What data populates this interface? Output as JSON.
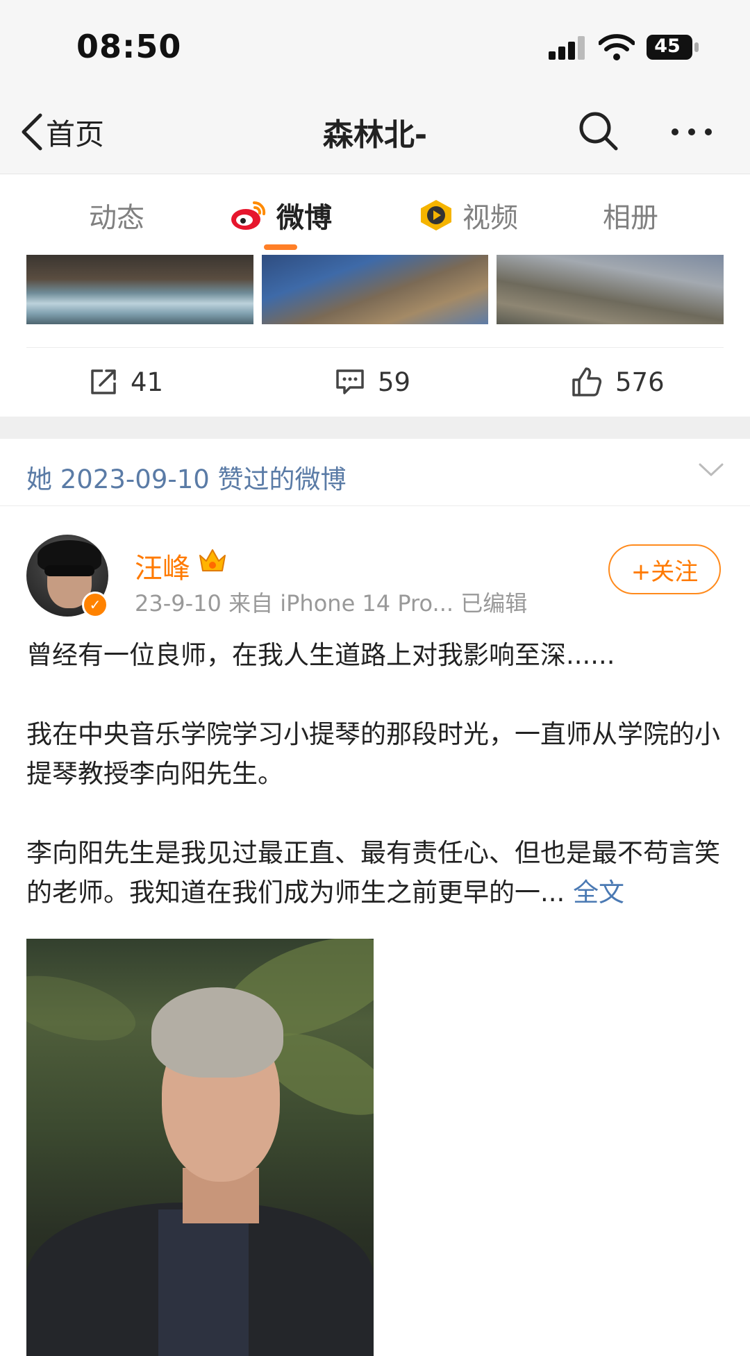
{
  "status_bar": {
    "time": "08:50",
    "battery": "45"
  },
  "nav": {
    "back_label": "首页",
    "title": "森林北-"
  },
  "tabs": [
    {
      "label": "动态"
    },
    {
      "label": "微博"
    },
    {
      "label": "视频"
    },
    {
      "label": "相册"
    }
  ],
  "active_tab": "微博",
  "prev_post_stats": {
    "shares": "41",
    "comments": "59",
    "likes": "576"
  },
  "liked_header": "她 2023-09-10 赞过的微博",
  "post": {
    "author": "汪峰",
    "meta": "23-9-10  来自 iPhone 14 Pro...  已编辑",
    "follow_label": "+关注",
    "paragraphs": [
      "曾经有一位良师，在我人生道路上对我影响至深......",
      "我在中央音乐学院学习小提琴的那段时光，一直师从学院的小提琴教授李向阳先生。",
      "李向阳先生是我见过最正直、最有责任心、但也是最不苟言笑的老师。我知道在我们成为师生之前更早的一..."
    ],
    "full_text_link": "全文"
  },
  "colors": {
    "accent": "#ff7f27",
    "link": "#4a79b3",
    "liked_header": "#5a7ba6"
  }
}
